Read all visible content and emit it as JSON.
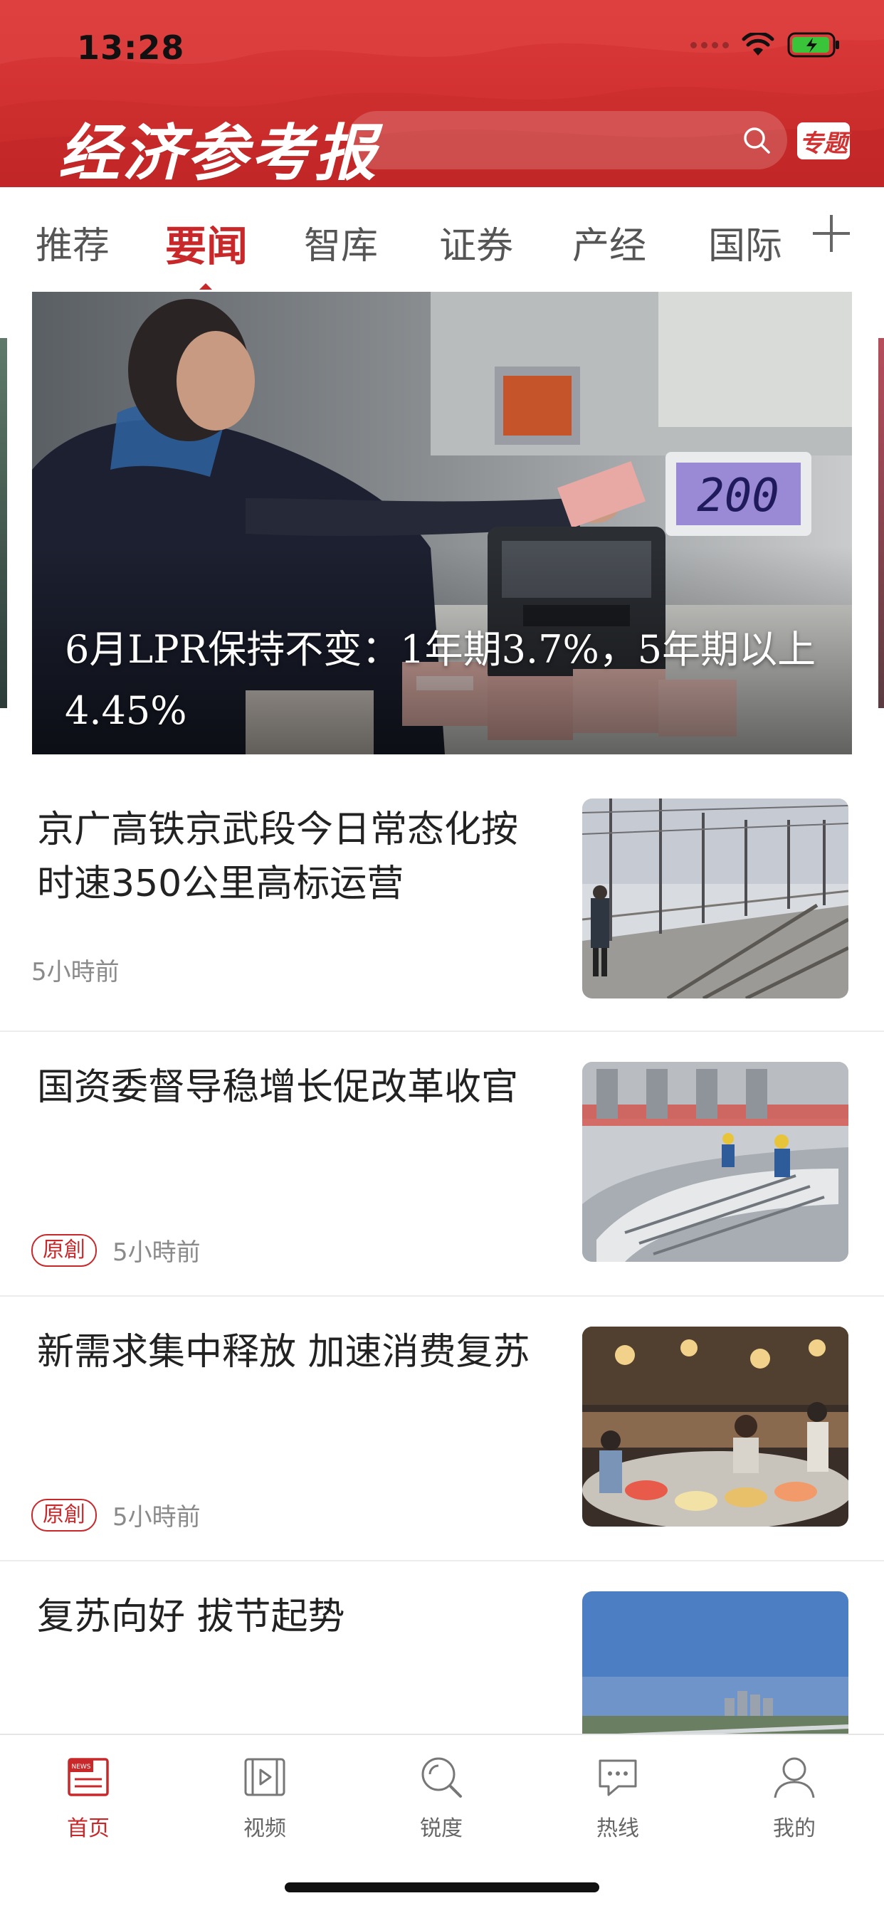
{
  "status_bar": {
    "time": "13:28"
  },
  "header": {
    "logo_text": "经济参考报",
    "search_placeholder": "",
    "topic_button_label": "专题",
    "brand_color": "#d23131"
  },
  "tabs": [
    {
      "label": "推荐",
      "active": false
    },
    {
      "label": "要闻",
      "active": true
    },
    {
      "label": "智库",
      "active": false
    },
    {
      "label": "证券",
      "active": false
    },
    {
      "label": "产经",
      "active": false
    },
    {
      "label": "国际",
      "active": false
    }
  ],
  "hero": {
    "caption": "6月LPR保持不变：1年期3.7%，5年期以上4.45%",
    "counter_display": "200"
  },
  "news": [
    {
      "title": "京广高铁京武段今日常态化按时速350公里高标运营",
      "badge": "",
      "time": "5小時前",
      "thumb": "railway"
    },
    {
      "title": "国资委督导稳增长促改革收官",
      "badge": "原創",
      "time": "5小時前",
      "thumb": "factory"
    },
    {
      "title": "新需求集中释放 加速消费复苏",
      "badge": "原創",
      "time": "5小時前",
      "thumb": "market"
    },
    {
      "title": "复苏向好 拔节起势",
      "badge": "",
      "time": "",
      "thumb": "city"
    }
  ],
  "tabbar": [
    {
      "label": "首页",
      "icon": "news-icon",
      "active": true
    },
    {
      "label": "视频",
      "icon": "video-icon",
      "active": false
    },
    {
      "label": "锐度",
      "icon": "search-icon",
      "active": false
    },
    {
      "label": "热线",
      "icon": "chat-icon",
      "active": false
    },
    {
      "label": "我的",
      "icon": "person-icon",
      "active": false
    }
  ]
}
